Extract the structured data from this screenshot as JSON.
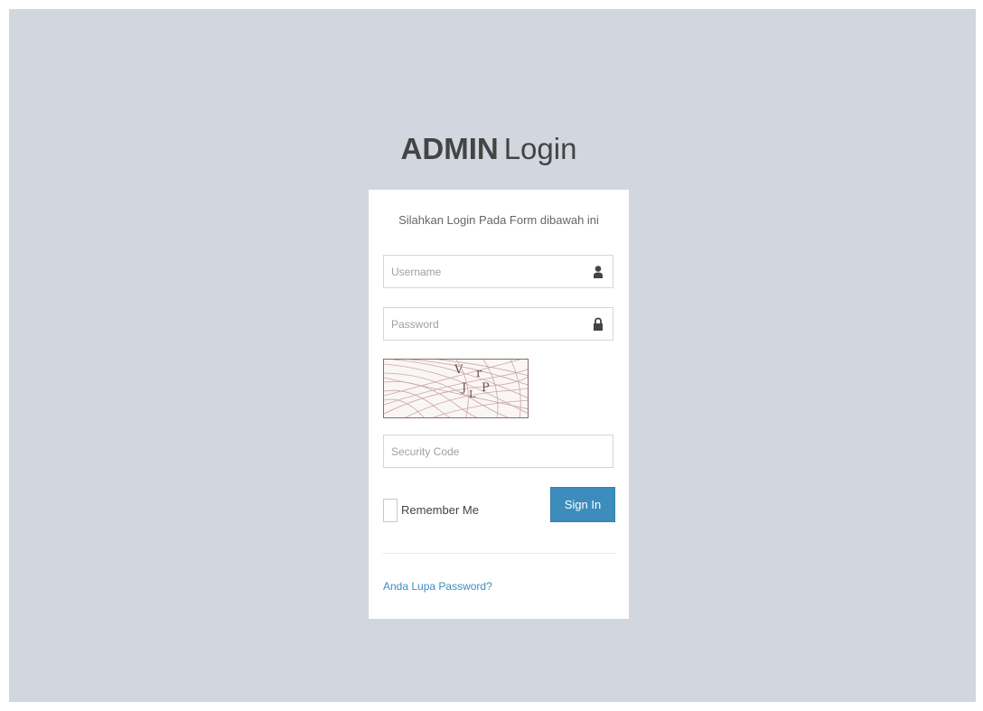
{
  "logo": {
    "bold": "ADMIN",
    "light": "Login"
  },
  "login_box": {
    "message": "Silahkan Login Pada Form dibawah ini",
    "username": {
      "placeholder": "Username",
      "value": "",
      "icon": "user-icon"
    },
    "password": {
      "placeholder": "Password",
      "value": "",
      "icon": "lock-icon"
    },
    "captcha": {
      "chars": [
        "V",
        "r",
        "J",
        "L",
        "P"
      ]
    },
    "security_code": {
      "placeholder": "Security Code",
      "value": ""
    },
    "remember_label": "Remember Me",
    "remember_checked": false,
    "signin_label": "Sign In",
    "forgot_link": "Anda Lupa Password?"
  },
  "colors": {
    "background": "#d2d6de",
    "primary": "#3c8dbc",
    "box": "#ffffff"
  }
}
